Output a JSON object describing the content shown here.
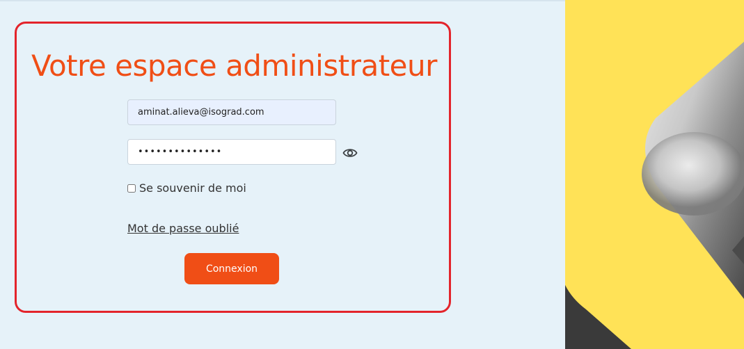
{
  "login": {
    "title": "Votre espace administrateur",
    "email_value": "aminat.alieva@isograd.com",
    "password_value": "aaaaaaaaaaaaaa",
    "remember_label": "Se souvenir de moi",
    "remember_checked": false,
    "forgot_label": "Mot de passe oublié",
    "submit_label": "Connexion"
  },
  "icons": {
    "password_toggle": "eye-icon"
  },
  "colors": {
    "accent": "#f04e16",
    "highlight_border": "#e3242b",
    "background": "#e6f2f9",
    "brand_yellow": "#ffe257"
  }
}
